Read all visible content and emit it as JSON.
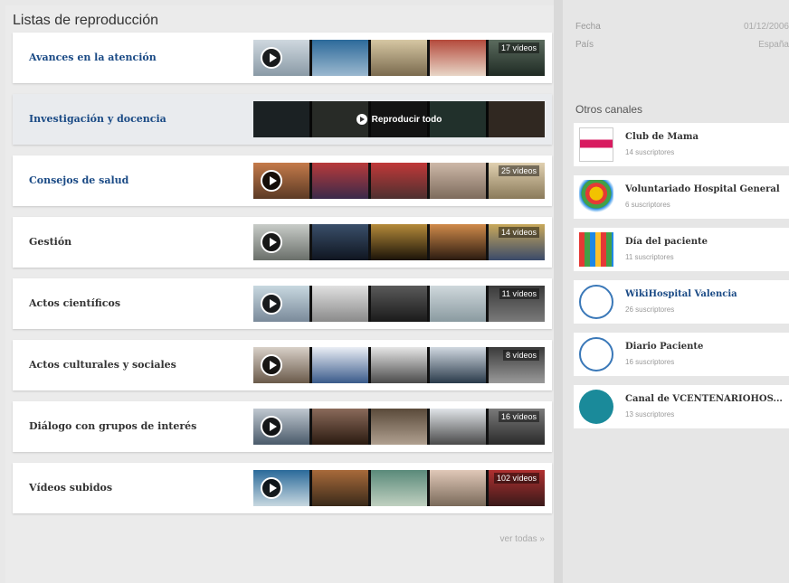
{
  "left": {
    "heading": "Listas de reproducción",
    "see_all": "ver todas »",
    "playlists": [
      {
        "title": "Avances en la atención",
        "count": "17 vídeos",
        "link": true
      },
      {
        "title": "Investigación y docencia",
        "play_all": "Reproducir todo",
        "link": true,
        "selected": true
      },
      {
        "title": "Consejos de salud",
        "count": "25 vídeos",
        "link": true
      },
      {
        "title": "Gestión",
        "count": "14 vídeos",
        "link": false
      },
      {
        "title": "Actos científicos",
        "count": "11 vídeos",
        "link": false
      },
      {
        "title": "Actos culturales y sociales",
        "count": "8 vídeos",
        "link": false
      },
      {
        "title": "Diálogo con grupos de interés",
        "count": "16 vídeos",
        "link": false
      },
      {
        "title": "Vídeos subidos",
        "count": "102 vídeos",
        "link": false
      }
    ]
  },
  "right": {
    "meta": [
      {
        "label": "Fecha",
        "value": "01/12/2006"
      },
      {
        "label": "País",
        "value": "España"
      }
    ],
    "other_title": "Otros canales",
    "channels": [
      {
        "name": "Club de Mama",
        "subs": "14 suscriptores",
        "icon": "club-mama-logo",
        "link": false
      },
      {
        "name": "Voluntariado Hospital General",
        "subs": "6 suscriptores",
        "icon": "volunteer-logo",
        "link": false
      },
      {
        "name": "Día del paciente",
        "subs": "11 suscriptores",
        "icon": "patient-day-logo",
        "link": false
      },
      {
        "name": "WikiHospital Valencia",
        "subs": "26 suscriptores",
        "icon": "wikihospital-logo",
        "link": true
      },
      {
        "name": "Diario Paciente",
        "subs": "16 suscriptores",
        "icon": "diario-paciente-logo",
        "link": false
      },
      {
        "name": "Canal de VCENTENARIOHOS...",
        "subs": "13 suscriptores",
        "icon": "centenario-logo",
        "link": false
      }
    ]
  },
  "colors": {
    "link": "#1a4a85",
    "text": "#333333",
    "muted": "#999999"
  }
}
